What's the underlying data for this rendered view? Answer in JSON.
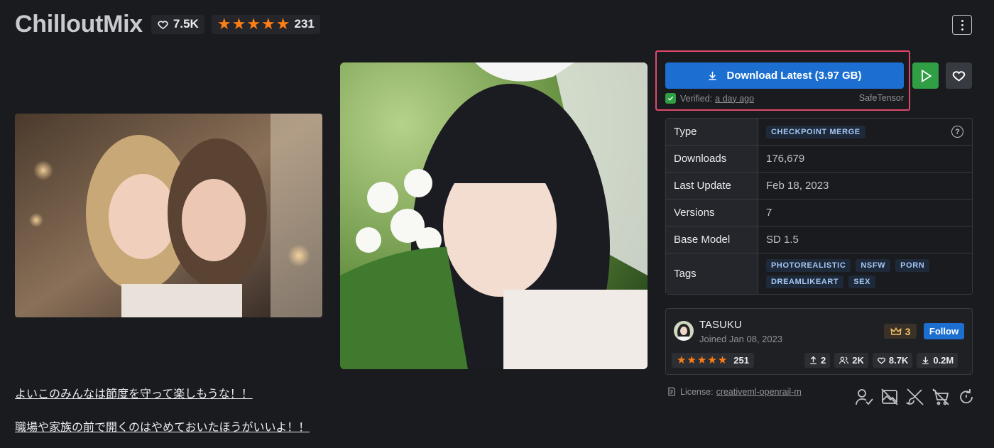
{
  "header": {
    "title": "ChilloutMix",
    "likes": "7.5K",
    "rating_count": "231",
    "star_count": 5
  },
  "download": {
    "label": "Download Latest (3.97 GB)",
    "verified_label": "Verified:",
    "verified_time": "a day ago",
    "format": "SafeTensor"
  },
  "details": {
    "type_label": "Type",
    "type_value": "CHECKPOINT MERGE",
    "downloads_label": "Downloads",
    "downloads_value": "176,679",
    "last_update_label": "Last Update",
    "last_update_value": "Feb 18, 2023",
    "versions_label": "Versions",
    "versions_value": "7",
    "base_model_label": "Base Model",
    "base_model_value": "SD 1.5",
    "tags_label": "Tags",
    "tags": [
      "PHOTOREALISTIC",
      "NSFW",
      "PORN",
      "DREAMLIKEART",
      "SEX"
    ]
  },
  "creator": {
    "name": "TASUKU",
    "joined": "Joined Jan 08, 2023",
    "crown_count": "3",
    "follow_label": "Follow",
    "rating_count": "251",
    "uploads": "2",
    "followers": "2K",
    "likes": "8.7K",
    "downloads": "0.2M"
  },
  "license": {
    "label": "License:",
    "name": "creativeml-openrail-m"
  },
  "description": {
    "line1": "よいこのみんなは節度を守って楽しもうな！！",
    "line2": "職場や家族の前で開くのはやめておいたほうがいいよ！！"
  },
  "colors": {
    "accent_blue": "#1c6fd1",
    "green": "#2f9e44",
    "star_orange": "#fd7e14",
    "highlight_pink": "#e0486b"
  }
}
